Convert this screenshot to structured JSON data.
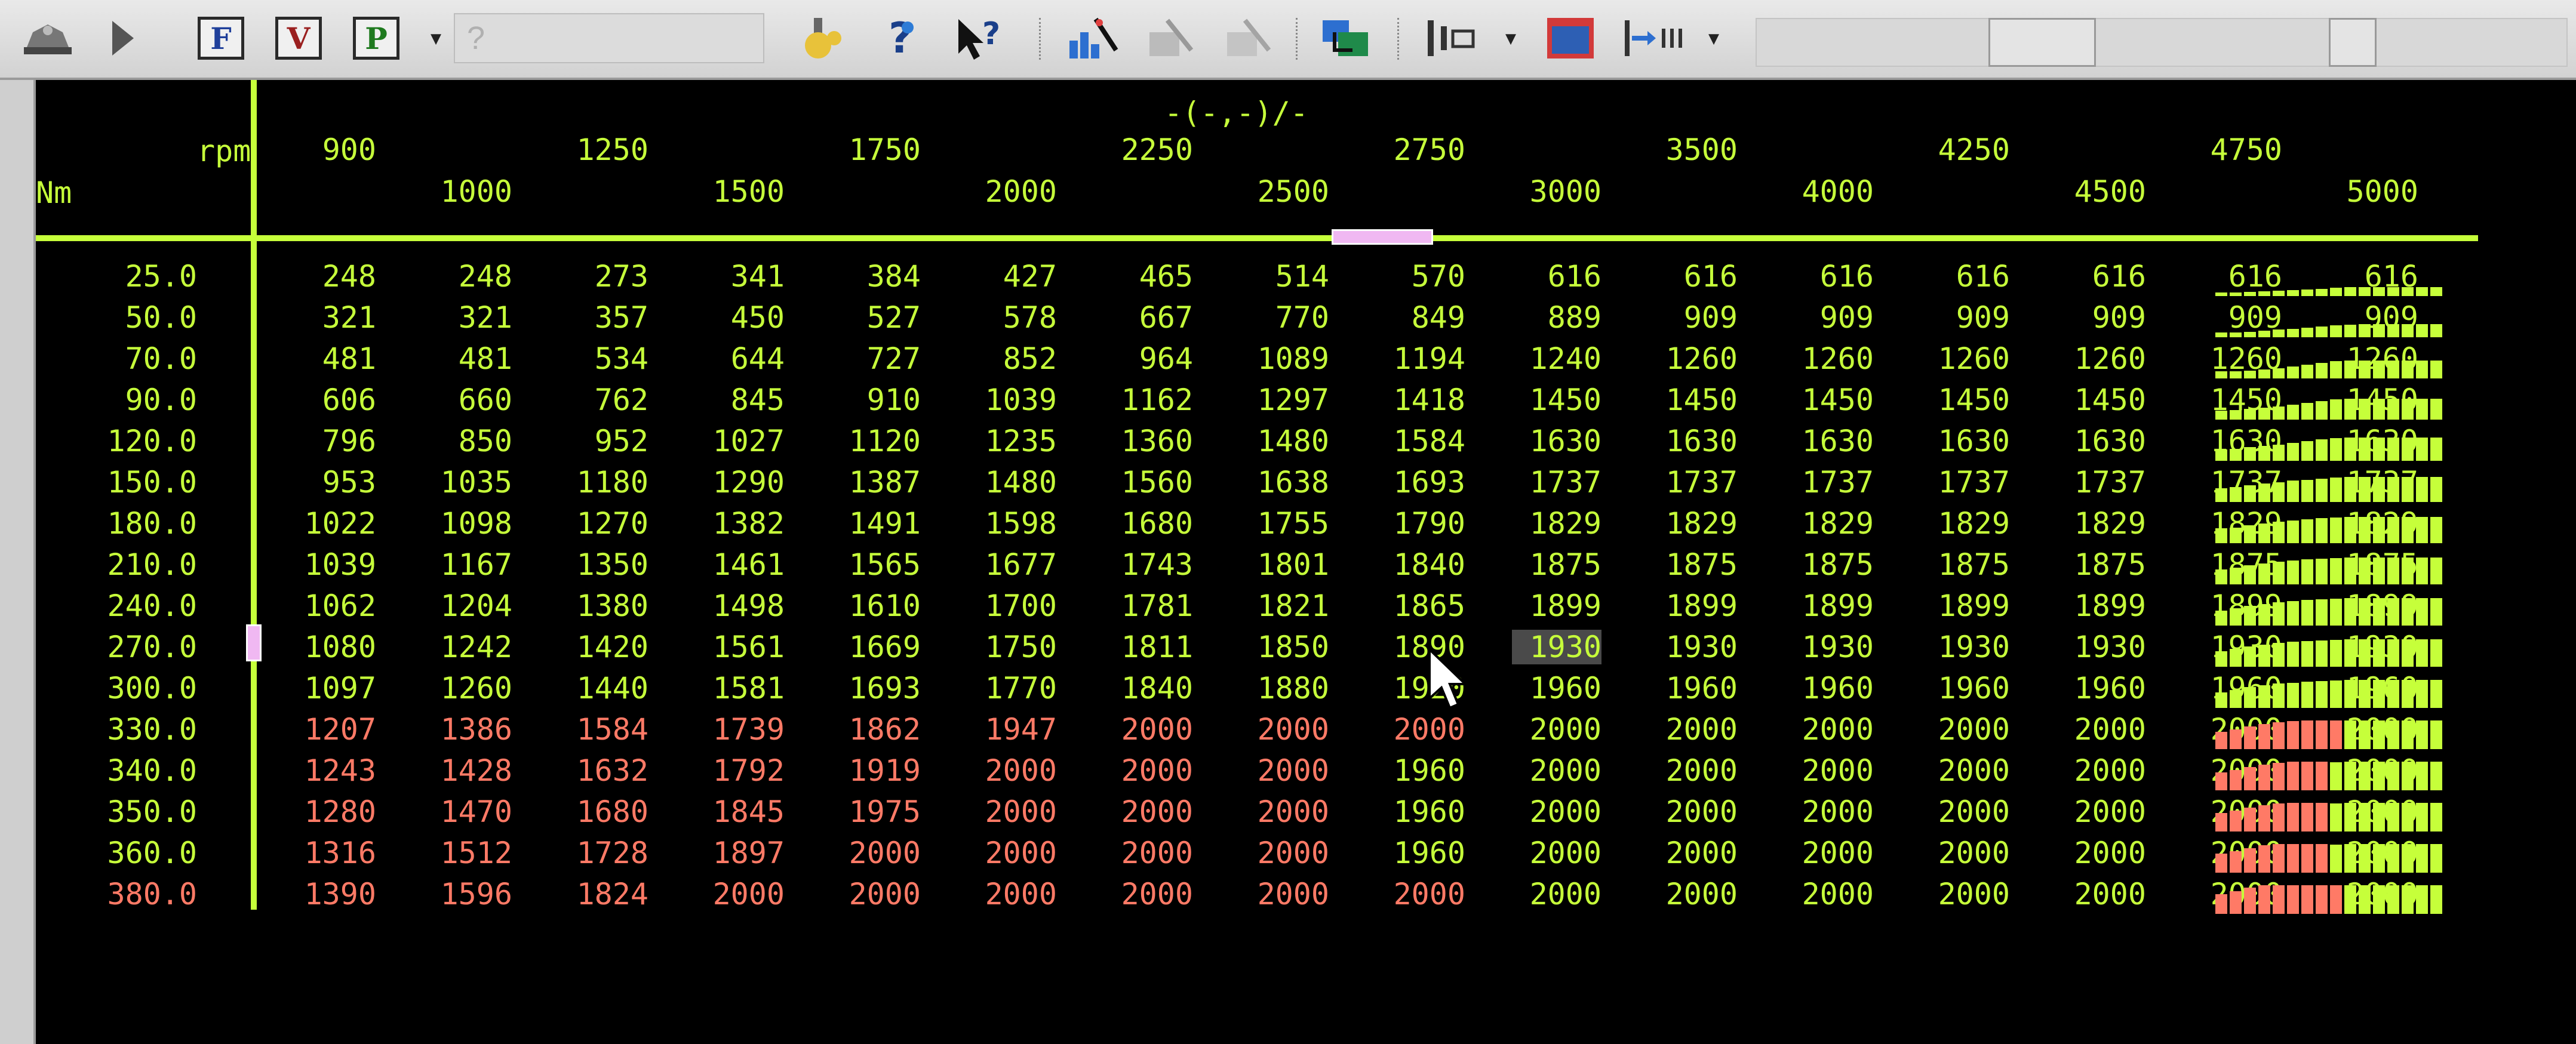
{
  "toolbar": {
    "f_label": "F",
    "v_label": "V",
    "p_label": "P",
    "help_placeholder": "?",
    "icons": [
      "car-icon",
      "play-icon",
      "f-button",
      "v-button",
      "p-button",
      "dropdown-icon",
      "build-icon",
      "help-icon",
      "pointer-help-icon",
      "chart-wand-icon",
      "tool-icon",
      "tool-icon-2",
      "layers-icon",
      "columns-icon",
      "dropdown-icon",
      "window-icon",
      "step-icon",
      "dropdown-icon"
    ],
    "colors": {
      "f": "#1f3f9a",
      "v": "#9a1f1f",
      "p": "#1f7a1f"
    }
  },
  "table": {
    "title": "-(-,-)/-",
    "rpm_label": "rpm",
    "nm_label": "Nm",
    "columns": [
      "900",
      "1000",
      "1250",
      "1500",
      "1750",
      "2000",
      "2250",
      "2500",
      "2750",
      "3000",
      "3500",
      "4000",
      "4250",
      "4500",
      "4750",
      "5000"
    ],
    "rows": [
      {
        "nm": "25.0",
        "red_count": 0,
        "values": [
          "248",
          "248",
          "273",
          "341",
          "384",
          "427",
          "465",
          "514",
          "570",
          "616",
          "616",
          "616",
          "616",
          "616",
          "616",
          "616"
        ]
      },
      {
        "nm": "50.0",
        "red_count": 0,
        "values": [
          "321",
          "321",
          "357",
          "450",
          "527",
          "578",
          "667",
          "770",
          "849",
          "889",
          "909",
          "909",
          "909",
          "909",
          "909",
          "909"
        ]
      },
      {
        "nm": "70.0",
        "red_count": 0,
        "values": [
          "481",
          "481",
          "534",
          "644",
          "727",
          "852",
          "964",
          "1089",
          "1194",
          "1240",
          "1260",
          "1260",
          "1260",
          "1260",
          "1260",
          "1260"
        ]
      },
      {
        "nm": "90.0",
        "red_count": 0,
        "values": [
          "606",
          "660",
          "762",
          "845",
          "910",
          "1039",
          "1162",
          "1297",
          "1418",
          "1450",
          "1450",
          "1450",
          "1450",
          "1450",
          "1450",
          "1450"
        ]
      },
      {
        "nm": "120.0",
        "red_count": 0,
        "values": [
          "796",
          "850",
          "952",
          "1027",
          "1120",
          "1235",
          "1360",
          "1480",
          "1584",
          "1630",
          "1630",
          "1630",
          "1630",
          "1630",
          "1630",
          "1630"
        ]
      },
      {
        "nm": "150.0",
        "red_count": 0,
        "values": [
          "953",
          "1035",
          "1180",
          "1290",
          "1387",
          "1480",
          "1560",
          "1638",
          "1693",
          "1737",
          "1737",
          "1737",
          "1737",
          "1737",
          "1737",
          "1737"
        ]
      },
      {
        "nm": "180.0",
        "red_count": 0,
        "values": [
          "1022",
          "1098",
          "1270",
          "1382",
          "1491",
          "1598",
          "1680",
          "1755",
          "1790",
          "1829",
          "1829",
          "1829",
          "1829",
          "1829",
          "1829",
          "1829"
        ]
      },
      {
        "nm": "210.0",
        "red_count": 0,
        "values": [
          "1039",
          "1167",
          "1350",
          "1461",
          "1565",
          "1677",
          "1743",
          "1801",
          "1840",
          "1875",
          "1875",
          "1875",
          "1875",
          "1875",
          "1875",
          "1875"
        ]
      },
      {
        "nm": "240.0",
        "red_count": 0,
        "values": [
          "1062",
          "1204",
          "1380",
          "1498",
          "1610",
          "1700",
          "1781",
          "1821",
          "1865",
          "1899",
          "1899",
          "1899",
          "1899",
          "1899",
          "1899",
          "1899"
        ]
      },
      {
        "nm": "270.0",
        "red_count": 0,
        "values": [
          "1080",
          "1242",
          "1420",
          "1561",
          "1669",
          "1750",
          "1811",
          "1850",
          "1890",
          "1930",
          "1930",
          "1930",
          "1930",
          "1930",
          "1930",
          "1930"
        ]
      },
      {
        "nm": "300.0",
        "red_count": 0,
        "values": [
          "1097",
          "1260",
          "1440",
          "1581",
          "1693",
          "1770",
          "1840",
          "1880",
          "1920",
          "1960",
          "1960",
          "1960",
          "1960",
          "1960",
          "1960",
          "1960"
        ]
      },
      {
        "nm": "330.0",
        "red_count": 9,
        "values": [
          "1207",
          "1386",
          "1584",
          "1739",
          "1862",
          "1947",
          "2000",
          "2000",
          "2000",
          "2000",
          "2000",
          "2000",
          "2000",
          "2000",
          "2000",
          "2000"
        ]
      },
      {
        "nm": "340.0",
        "red_count": 8,
        "values": [
          "1243",
          "1428",
          "1632",
          "1792",
          "1919",
          "2000",
          "2000",
          "2000",
          "1960",
          "2000",
          "2000",
          "2000",
          "2000",
          "2000",
          "2000",
          "2000"
        ]
      },
      {
        "nm": "350.0",
        "red_count": 8,
        "values": [
          "1280",
          "1470",
          "1680",
          "1845",
          "1975",
          "2000",
          "2000",
          "2000",
          "1960",
          "2000",
          "2000",
          "2000",
          "2000",
          "2000",
          "2000",
          "2000"
        ]
      },
      {
        "nm": "360.0",
        "red_count": 8,
        "values": [
          "1316",
          "1512",
          "1728",
          "1897",
          "2000",
          "2000",
          "2000",
          "2000",
          "1960",
          "2000",
          "2000",
          "2000",
          "2000",
          "2000",
          "2000",
          "2000"
        ]
      },
      {
        "nm": "380.0",
        "red_count": 9,
        "values": [
          "1390",
          "1596",
          "1824",
          "2000",
          "2000",
          "2000",
          "2000",
          "2000",
          "2000",
          "2000",
          "2000",
          "2000",
          "2000",
          "2000",
          "2000",
          "2000"
        ]
      }
    ],
    "selected": {
      "row": 9,
      "col": 9
    },
    "colors": {
      "normal": "#c6ff3a",
      "limit": "#ff7a66"
    }
  }
}
